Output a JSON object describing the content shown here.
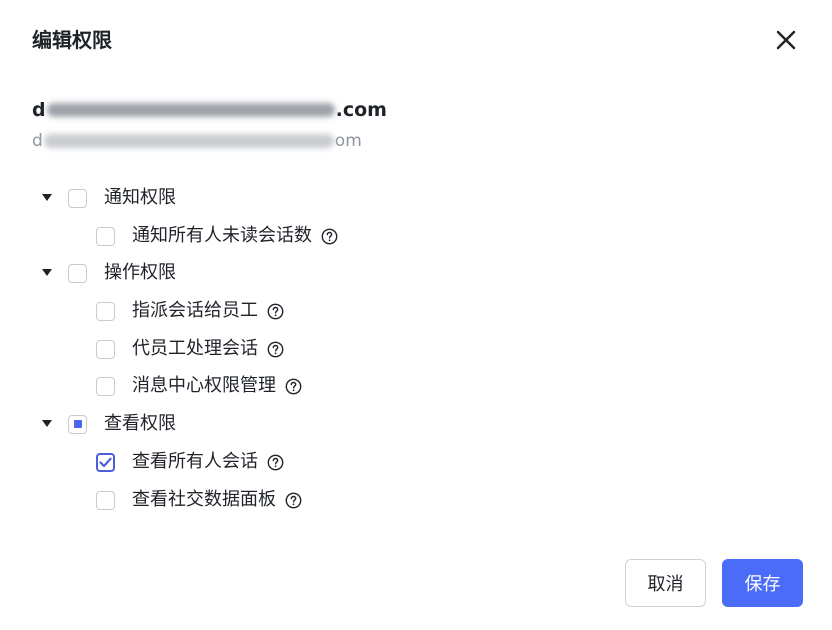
{
  "dialog": {
    "title": "编辑权限",
    "close_icon": "close-icon"
  },
  "account": {
    "email_primary_suffix": ".com",
    "email_primary_prefix": "d",
    "email_secondary_prefix": "d",
    "email_secondary_suffix": "om"
  },
  "permissions": {
    "groups": [
      {
        "label": "通知权限",
        "state": "unchecked",
        "expanded": true,
        "items": [
          {
            "label": "通知所有人未读会话数",
            "checked": false,
            "help_icon": "question-circle-icon"
          }
        ]
      },
      {
        "label": "操作权限",
        "state": "unchecked",
        "expanded": true,
        "items": [
          {
            "label": "指派会话给员工",
            "checked": false,
            "help_icon": "question-circle-icon"
          },
          {
            "label": "代员工处理会话",
            "checked": false,
            "help_icon": "question-circle-icon"
          },
          {
            "label": "消息中心权限管理",
            "checked": false,
            "help_icon": "question-circle-icon"
          }
        ]
      },
      {
        "label": "查看权限",
        "state": "indeterminate",
        "expanded": true,
        "items": [
          {
            "label": "查看所有人会话",
            "checked": true,
            "help_icon": "question-circle-icon"
          },
          {
            "label": "查看社交数据面板",
            "checked": false,
            "help_icon": "question-circle-icon"
          }
        ]
      }
    ]
  },
  "footer": {
    "cancel_label": "取消",
    "save_label": "保存"
  },
  "colors": {
    "primary": "#4a6cf7",
    "checkbox_border": "#c8cbd0",
    "text": "#1f2329",
    "muted_text": "#8f959e"
  }
}
